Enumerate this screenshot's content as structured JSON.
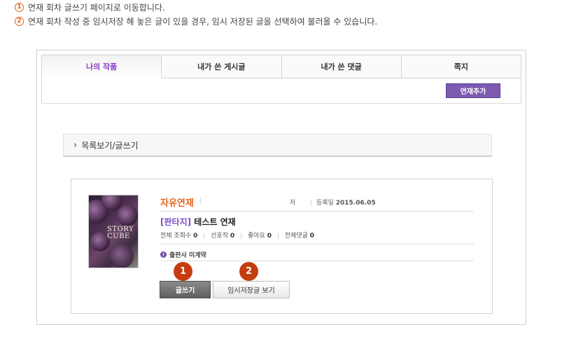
{
  "notes": [
    {
      "num": "1",
      "text": "연재 회차 글쓰기 페이지로 이동합니다."
    },
    {
      "num": "2",
      "text": "연재 회차 작성 중 임시저장 해 놓은 글이 있을 경우, 임시 저장된 글을 선택하여 불러올 수 있습니다."
    }
  ],
  "tabs": [
    {
      "label": "나의 작품",
      "active": true
    },
    {
      "label": "내가 쓴 게시글",
      "active": false
    },
    {
      "label": "내가 쓴 댓글",
      "active": false
    },
    {
      "label": "쪽지",
      "active": false
    }
  ],
  "add_button": "연재추가",
  "list_bar": {
    "chevron": "›",
    "label": "목록보기/글쓰기"
  },
  "work": {
    "cover_text_1": "STORY",
    "cover_text_2": "CUBE",
    "genre_title": "자유연재",
    "author_label": "저",
    "date_label": "등록일",
    "date_value": "2015.06.05",
    "category": "[판타지]",
    "title": "테스트 연재",
    "stats": [
      {
        "label": "전체 조회수",
        "value": "0"
      },
      {
        "label": "선호작",
        "value": "0"
      },
      {
        "label": "좋아요",
        "value": "0"
      },
      {
        "label": "전체댓글",
        "value": "0"
      }
    ],
    "publisher_status": "출판사 미계약",
    "publisher_icon": "!"
  },
  "badges": [
    "1",
    "2"
  ],
  "buttons": {
    "write": "글쓰기",
    "drafts": "임시저장글 보기"
  },
  "colors": {
    "accent_purple": "#7b5ab0",
    "genre_orange": "#e2641e",
    "badge_red": "#c53c10"
  }
}
